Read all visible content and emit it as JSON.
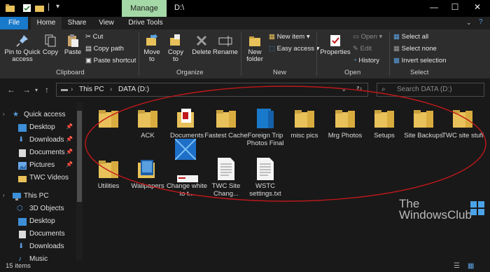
{
  "titlebar": {
    "manage_tab": "Manage",
    "window_title": "D:\\",
    "minimize_glyph": "—",
    "maximize_glyph": "☐",
    "close_glyph": "✕"
  },
  "ribbon_tabs": [
    "File",
    "Home",
    "Share",
    "View",
    "Drive Tools"
  ],
  "ribbon": {
    "clipboard": {
      "label": "Clipboard",
      "pin": "Pin to Quick access",
      "copy": "Copy",
      "paste": "Paste",
      "cut": "Cut",
      "copy_path": "Copy path",
      "paste_shortcut": "Paste shortcut"
    },
    "organize": {
      "label": "Organize",
      "move_to": "Move to",
      "copy_to": "Copy to",
      "delete": "Delete",
      "rename": "Rename"
    },
    "new": {
      "label": "New",
      "new_folder": "New folder",
      "new_item": "New item",
      "easy_access": "Easy access"
    },
    "open": {
      "label": "Open",
      "properties": "Properties",
      "open": "Open",
      "edit": "Edit",
      "history": "History"
    },
    "select": {
      "label": "Select",
      "select_all": "Select all",
      "select_none": "Select none",
      "invert_selection": "Invert selection"
    }
  },
  "address": {
    "crumb_1": "This PC",
    "crumb_2": "DATA (D:)",
    "search_placeholder": "Search DATA (D:)"
  },
  "sidebar": {
    "quick_access": "Quick access",
    "qa_items": [
      "Desktop",
      "Downloads",
      "Documents",
      "Pictures",
      "TWC Videos"
    ],
    "this_pc": "This PC",
    "pc_items": [
      "3D Objects",
      "Desktop",
      "Documents",
      "Downloads",
      "Music"
    ]
  },
  "files": [
    {
      "name": "",
      "type": "folder"
    },
    {
      "name": "ACK",
      "type": "folder"
    },
    {
      "name": "Documents",
      "type": "folder-docs"
    },
    {
      "name": "Fastest Cache",
      "type": "folder"
    },
    {
      "name": "Foreign Trip Photos Final",
      "type": "folder-blue"
    },
    {
      "name": "misc pics",
      "type": "folder"
    },
    {
      "name": "Mrg Photos",
      "type": "folder"
    },
    {
      "name": "Setups",
      "type": "folder"
    },
    {
      "name": "Site Backups",
      "type": "folder"
    },
    {
      "name": "TWC site stuff",
      "type": "folder"
    },
    {
      "name": "Utilities",
      "type": "folder"
    },
    {
      "name": "Wallpapers",
      "type": "folder-wall"
    },
    {
      "name": "Change white to t...",
      "type": "image"
    },
    {
      "name": "TWC Site Chang...",
      "type": "text"
    },
    {
      "name": "WSTC settings.txt",
      "type": "text"
    }
  ],
  "status": {
    "item_count": "15 items"
  },
  "watermark": {
    "line1": "The",
    "line2": "WindowsClub"
  },
  "colors": {
    "folder": "#e8c15a",
    "accent": "#1979ca",
    "annotation": "#c0181b",
    "manage_tab_bg": "#a4d8a6"
  }
}
